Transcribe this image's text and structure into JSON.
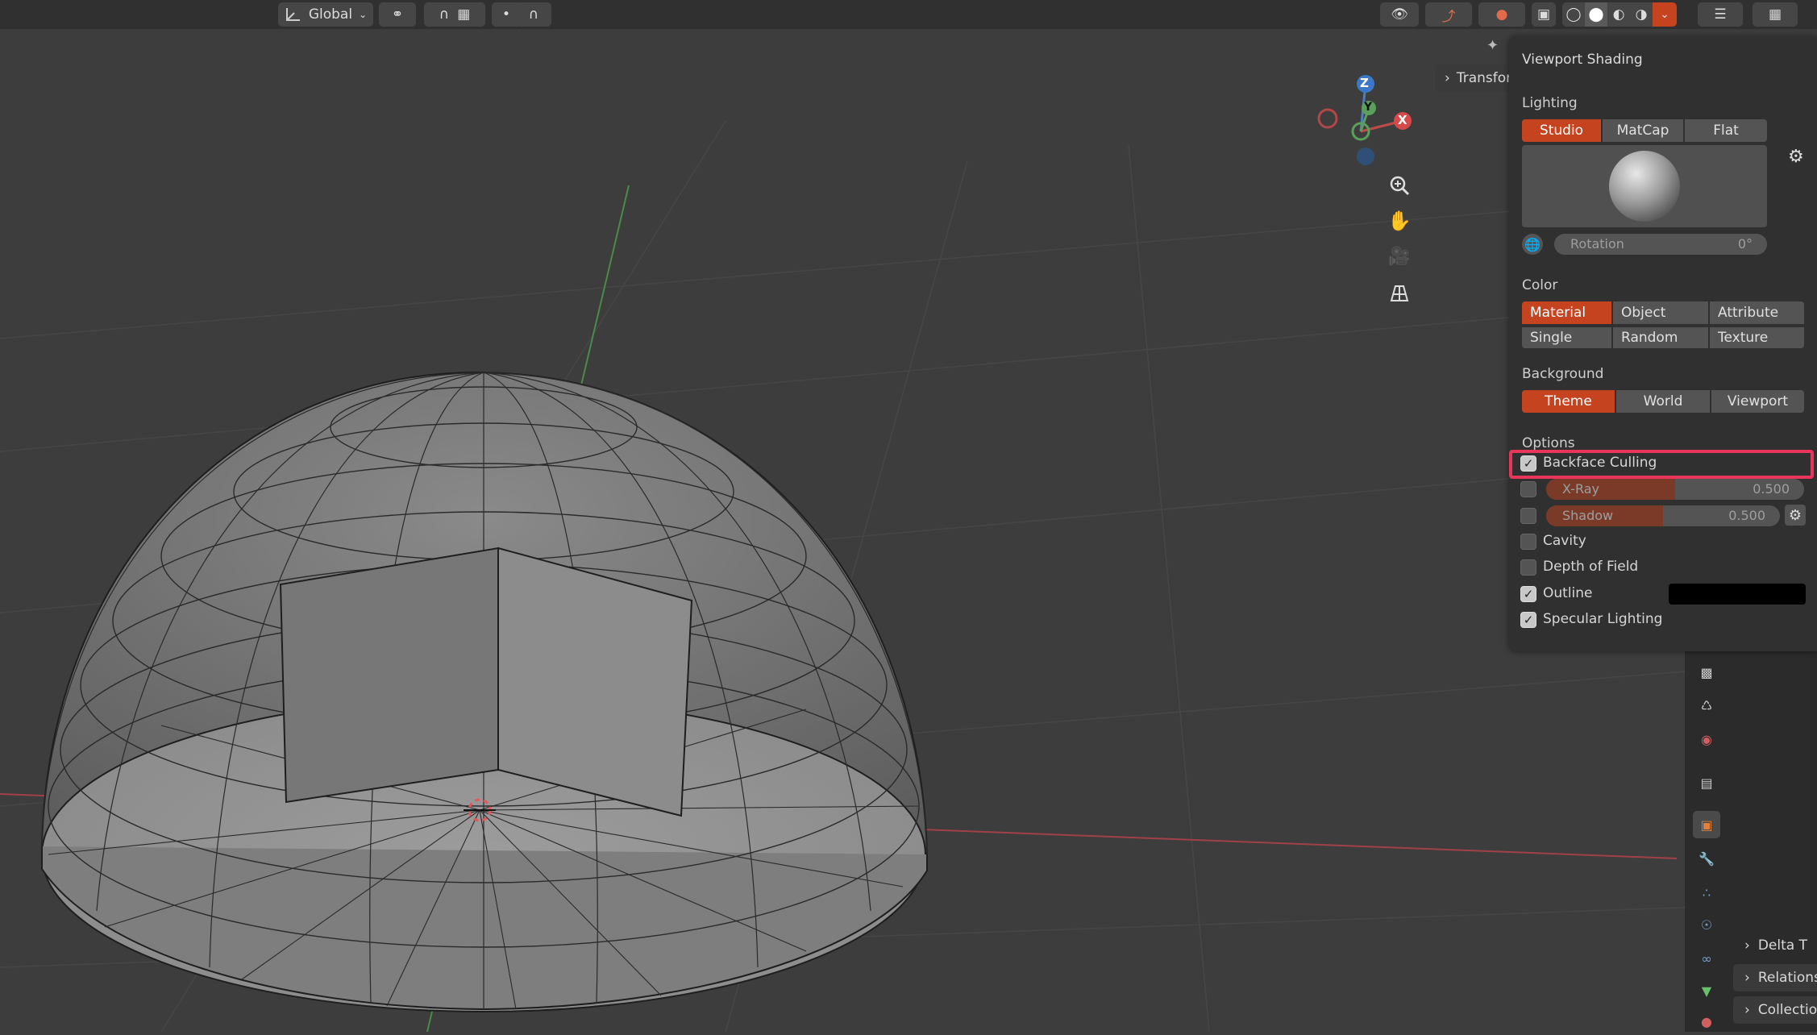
{
  "header": {
    "orientation_label": "Global",
    "transform_tab": "Transform"
  },
  "viewport_shading": {
    "title": "Viewport Shading",
    "lighting": {
      "label": "Lighting",
      "options": [
        "Studio",
        "MatCap",
        "Flat"
      ],
      "selected": "Studio",
      "rotation_label": "Rotation",
      "rotation_value": "0°"
    },
    "color": {
      "label": "Color",
      "options": [
        "Material",
        "Object",
        "Attribute",
        "Single",
        "Random",
        "Texture"
      ],
      "selected": "Material"
    },
    "background": {
      "label": "Background",
      "options": [
        "Theme",
        "World",
        "Viewport"
      ],
      "selected": "Theme"
    },
    "options": {
      "label": "Options",
      "backface_culling": {
        "label": "Backface Culling",
        "checked": true
      },
      "xray": {
        "label": "X-Ray",
        "checked": false,
        "value": "0.500",
        "level": 0.5
      },
      "shadow": {
        "label": "Shadow",
        "checked": false,
        "value": "0.500",
        "level": 0.5
      },
      "cavity": {
        "label": "Cavity",
        "checked": false
      },
      "depth_of_field": {
        "label": "Depth of Field",
        "checked": false
      },
      "outline": {
        "label": "Outline",
        "checked": true,
        "color": "#000000"
      },
      "specular_lighting": {
        "label": "Specular Lighting",
        "checked": true
      }
    }
  },
  "gizmo": {
    "z": "Z",
    "y": "Y",
    "x": "X"
  },
  "properties_panel": {
    "items": [
      "Delta T",
      "Relations",
      "Collection"
    ]
  },
  "colors": {
    "accent": "#c5431f",
    "highlight_box": "#e8365a",
    "panel_bg": "#303030",
    "viewport_bg": "#3d3d3d"
  }
}
